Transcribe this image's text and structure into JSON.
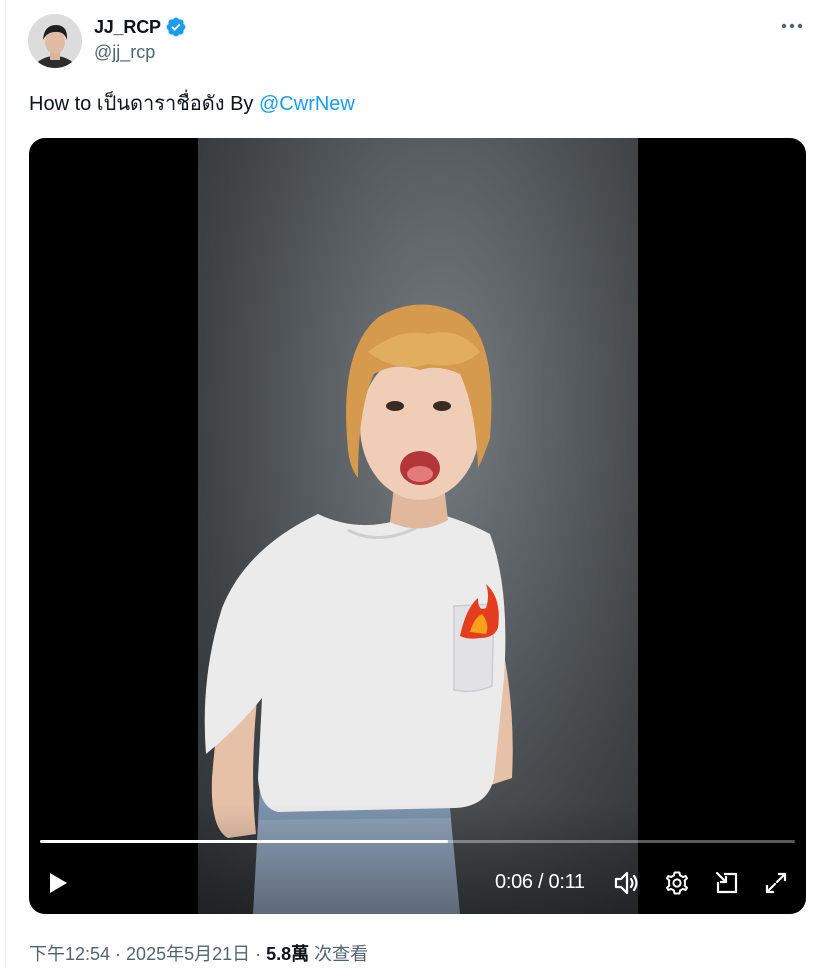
{
  "author": {
    "display_name": "JJ_RCP",
    "handle": "@jj_rcp",
    "verified_icon": "verified-badge-icon"
  },
  "tweet": {
    "text_prefix": "How to เป็นดาราชื่อดัง By ",
    "mention": "@CwrNew"
  },
  "video": {
    "current_time": "0:06",
    "separator": " / ",
    "duration": "0:11",
    "progress_fraction": 0.54,
    "icons": [
      "play-icon",
      "volume-icon",
      "settings-icon",
      "pip-icon",
      "fullscreen-icon"
    ]
  },
  "meta": {
    "time": "下午12:54",
    "dot1": " · ",
    "date": "2025年5月21日",
    "dot2": " · ",
    "views_count": "5.8萬",
    "views_label": " 次查看"
  },
  "colors": {
    "accent": "#1d9bf0",
    "secondary_text": "#536471",
    "primary_text": "#0f1419"
  }
}
